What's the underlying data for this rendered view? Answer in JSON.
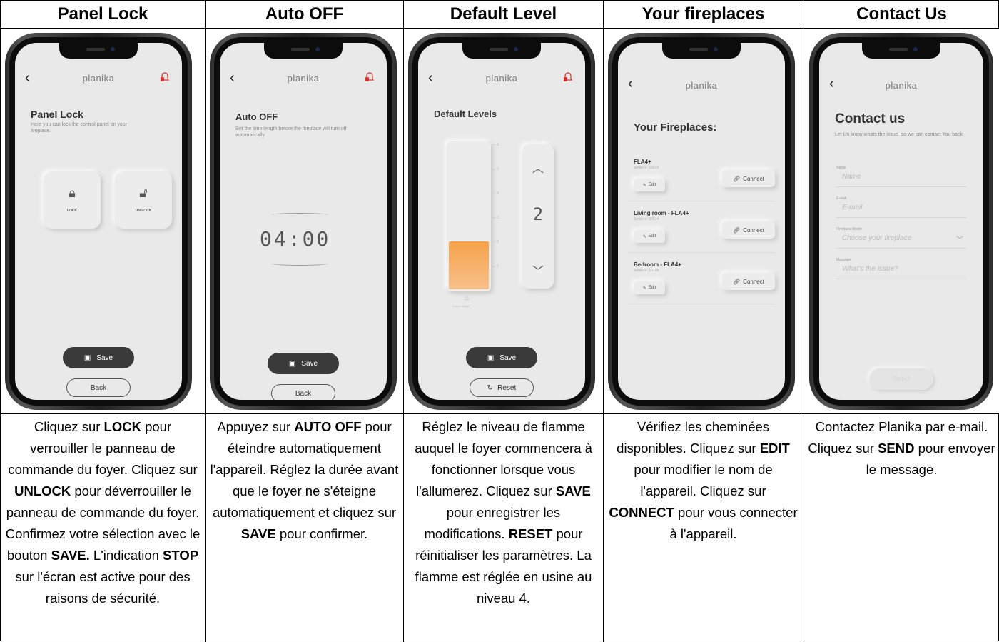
{
  "brand": "planika",
  "columns": [
    {
      "header": "Panel Lock",
      "screen": {
        "title": "Panel Lock",
        "subtitle": "Here you can lock the control panel on your fireplace.",
        "lock_label": "LOCK",
        "unlock_label": "UN LOCK",
        "save_label": "Save",
        "back_label": "Back"
      },
      "desc": [
        {
          "t": "Cliquez sur "
        },
        {
          "b": "LOCK"
        },
        {
          "t": " pour verrouiller le panneau de commande du foyer. Cliquez sur "
        },
        {
          "b": "UNLOCK"
        },
        {
          "t": " pour déverrouiller le panneau de commande du foyer. Confirmez votre sélection avec le bouton "
        },
        {
          "b": "SAVE."
        },
        {
          "t": " L'indication "
        },
        {
          "b": "STOP"
        },
        {
          "t": " sur l'écran est active pour des raisons de sécurité."
        }
      ]
    },
    {
      "header": "Auto OFF",
      "screen": {
        "title": "Auto OFF",
        "subtitle": "Set the time length before the fireplace will turn off automatically",
        "timer": "04:00",
        "save_label": "Save",
        "back_label": "Back"
      },
      "desc": [
        {
          "t": "Appuyez sur "
        },
        {
          "b": "AUTO OFF"
        },
        {
          "t": " pour éteindre automatiquement l'appareil. Réglez la durée avant que le foyer ne s'éteigne automatiquement et cliquez sur "
        },
        {
          "b": "SAVE"
        },
        {
          "t": " pour confirmer."
        }
      ]
    },
    {
      "header": "Default Level",
      "screen": {
        "title": "Default Levels",
        "level_value": "2",
        "level_fraction": 0.33,
        "scale_ticks": [
          "6",
          "5",
          "4",
          "3",
          "2",
          "1"
        ],
        "flame_label": "Flame height",
        "save_label": "Save",
        "reset_label": "Reset"
      },
      "desc": [
        {
          "t": "Réglez le niveau de flamme auquel le foyer commencera à fonctionner lorsque vous l'allumerez. Cliquez sur "
        },
        {
          "b": "SAVE"
        },
        {
          "t": " pour enregistrer les modifications. "
        },
        {
          "b": "RESET"
        },
        {
          "t": " pour réinitialiser les paramètres. La flamme est réglée en usine au niveau 4."
        }
      ]
    },
    {
      "header": "Your fireplaces",
      "screen": {
        "title": "Your Fireplaces:",
        "edit_label": "Edit",
        "connect_label": "Connect",
        "items": [
          {
            "name": "FLA4+",
            "serial": "Serial nr: 10010"
          },
          {
            "name": "Living room - FLA4+",
            "serial": "Serial nr: 09614"
          },
          {
            "name": "Bedroom - FLA4+",
            "serial": "Serial nr: 10138"
          }
        ]
      },
      "desc": [
        {
          "t": "Vérifiez les cheminées disponibles. Cliquez sur "
        },
        {
          "b": "EDIT"
        },
        {
          "t": " pour modifier le nom de l'appareil. Cliquez sur "
        },
        {
          "b": "CONNECT"
        },
        {
          "t": " pour vous connecter à l'appareil."
        }
      ]
    },
    {
      "header": "Contact Us",
      "screen": {
        "title": "Contact us",
        "subtitle": "Let Us know whats the issue, so we can contact You back",
        "fields": [
          {
            "label": "Name",
            "placeholder": "Name"
          },
          {
            "label": "E-mail",
            "placeholder": "E-mail"
          },
          {
            "label": "Fireplace Model",
            "placeholder": "Choose your fireplace"
          },
          {
            "label": "Message",
            "placeholder": "What's the issue?"
          }
        ],
        "send_label": "Send"
      },
      "desc": [
        {
          "t": "Contactez Planika par e-mail. Cliquez sur "
        },
        {
          "b": "SEND"
        },
        {
          "t": " pour envoyer le message."
        }
      ]
    }
  ]
}
